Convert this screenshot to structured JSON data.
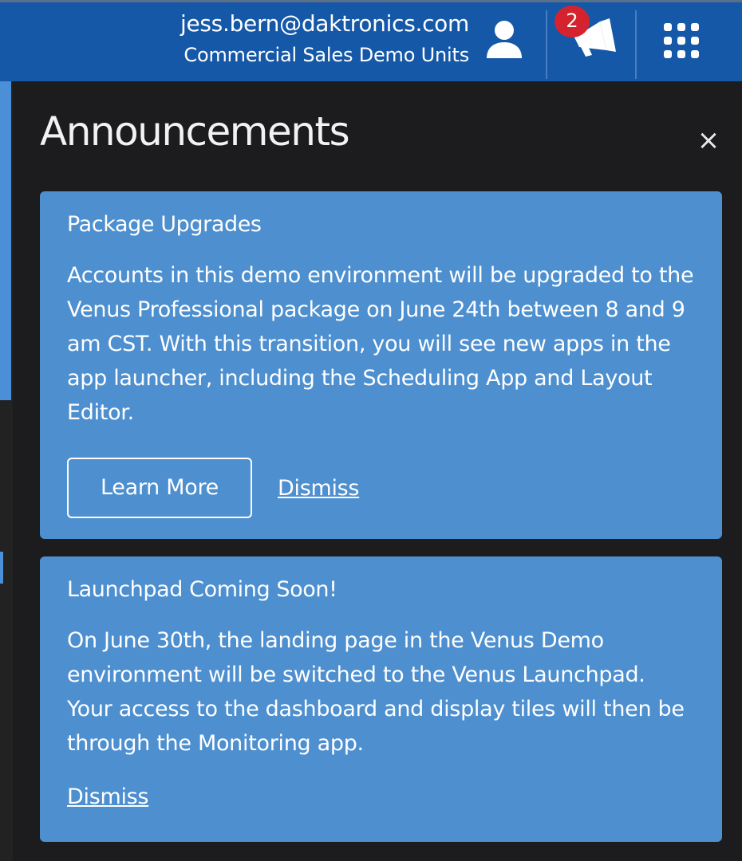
{
  "header": {
    "user_email": "jess.bern@daktronics.com",
    "account_name": "Commercial Sales Demo Units",
    "notification_count": "2",
    "user_icon": "user-icon",
    "announcements_icon": "megaphone-icon",
    "app_launcher_icon": "grid-icon",
    "bg_color": "#1558a8",
    "badge_color": "#d4232e"
  },
  "panel": {
    "title": "Announcements",
    "close_label": "×",
    "bg_color": "#1c1c1e",
    "card_color": "#4d8fcf"
  },
  "announcements": [
    {
      "title": "Package Upgrades",
      "body": "Accounts in this demo environment will be upgraded to the Venus Professional package on June 24th between 8 and 9 am CST. With this transition, you will see new apps in the app launcher, including the Scheduling App and Layout Editor.",
      "learn_more_label": "Learn More",
      "dismiss_label": "Dismiss"
    },
    {
      "title": "Launchpad Coming Soon!",
      "body": "On June 30th, the landing page in the Venus Demo environment will be switched to the Venus Launchpad. Your access to the dashboard and display tiles will then be through the Monitoring app.",
      "dismiss_label": "Dismiss"
    }
  ]
}
